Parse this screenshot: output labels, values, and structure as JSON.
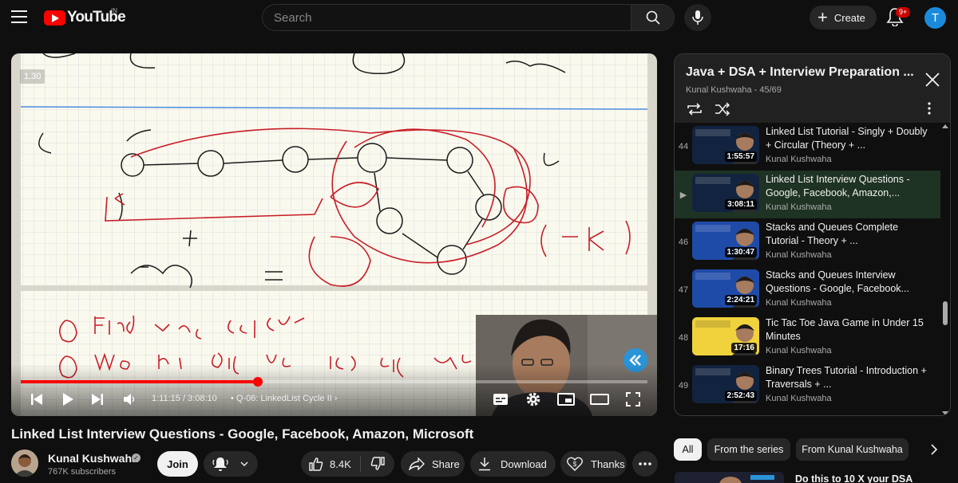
{
  "header": {
    "logo_text": "YouTube",
    "country_code": "IN",
    "search_placeholder": "Search",
    "create_label": "Create",
    "notifications_badge": "9+",
    "account_initial": "T"
  },
  "player": {
    "speed_label": "1.30",
    "current_time": "1:11:15",
    "duration": "3:08:10",
    "time_display": "1:11:15 / 3:08:10",
    "chapter_label": "Q-06: LinkedList Cycle II",
    "progress_fraction": 0.378,
    "board_handwriting": [
      "meet",
      "Find length of cycle",
      "move 1 ahead by length of cycle",
      "(l-k)",
      "l - (l-k) ="
    ],
    "colors": {
      "progress": "#ff0000",
      "ink_red": "#c81e28",
      "ink_black": "#1a1a1a",
      "badge": "#2a94d8"
    }
  },
  "video": {
    "title": "Linked List Interview Questions - Google, Facebook, Amazon, Microsoft",
    "channel": "Kunal Kushwaha",
    "subscribers": "767K subscribers",
    "join_label": "Join",
    "likes": "8.4K",
    "share_label": "Share",
    "download_label": "Download",
    "thanks_label": "Thanks"
  },
  "playlist": {
    "title": "Java + DSA + Interview Preparation ...",
    "subtitle": "Kunal Kushwaha - 45/69",
    "items": [
      {
        "index": "44",
        "title": "Linked List Tutorial - Singly + Doubly + Circular (Theory + ...",
        "channel": "Kunal Kushwaha",
        "duration": "1:55:57",
        "thumb_label": "LINKED LIST",
        "thumb_color": "#12233f",
        "active": false
      },
      {
        "index": "▶",
        "title": "Linked List Interview Questions - Google, Facebook, Amazon,...",
        "channel": "Kunal Kushwaha",
        "duration": "3:08:11",
        "thumb_label": "LINKED LIST",
        "thumb_color": "#12233f",
        "active": true
      },
      {
        "index": "46",
        "title": "Stacks and Queues Complete Tutorial - Theory + ...",
        "channel": "Kunal Kushwaha",
        "duration": "1:30:47",
        "thumb_label": "STACKS & QUEUES",
        "thumb_color": "#1f4ba8",
        "active": false
      },
      {
        "index": "47",
        "title": "Stacks and Queues Interview Questions - Google, Facebook...",
        "channel": "Kunal Kushwaha",
        "duration": "2:24:21",
        "thumb_label": "STACKS & QUEUES",
        "thumb_color": "#1f4ba8",
        "active": false
      },
      {
        "index": "48",
        "title": "Tic Tac Toe Java Game in Under 15 Minutes",
        "channel": "Kunal Kushwaha",
        "duration": "17:16",
        "thumb_label": "Tic Tac Toe",
        "thumb_color": "#f0d23c",
        "active": false
      },
      {
        "index": "49",
        "title": "Binary Trees Tutorial - Introduction + Traversals + ...",
        "channel": "Kunal Kushwaha",
        "duration": "2:52:43",
        "thumb_label": "BINARY TREES",
        "thumb_color": "#12233f",
        "active": false
      }
    ]
  },
  "chips": [
    "All",
    "From the series",
    "From Kunal Kushwaha"
  ],
  "recommendation": {
    "title": "Do this to 10 X your DSA"
  }
}
